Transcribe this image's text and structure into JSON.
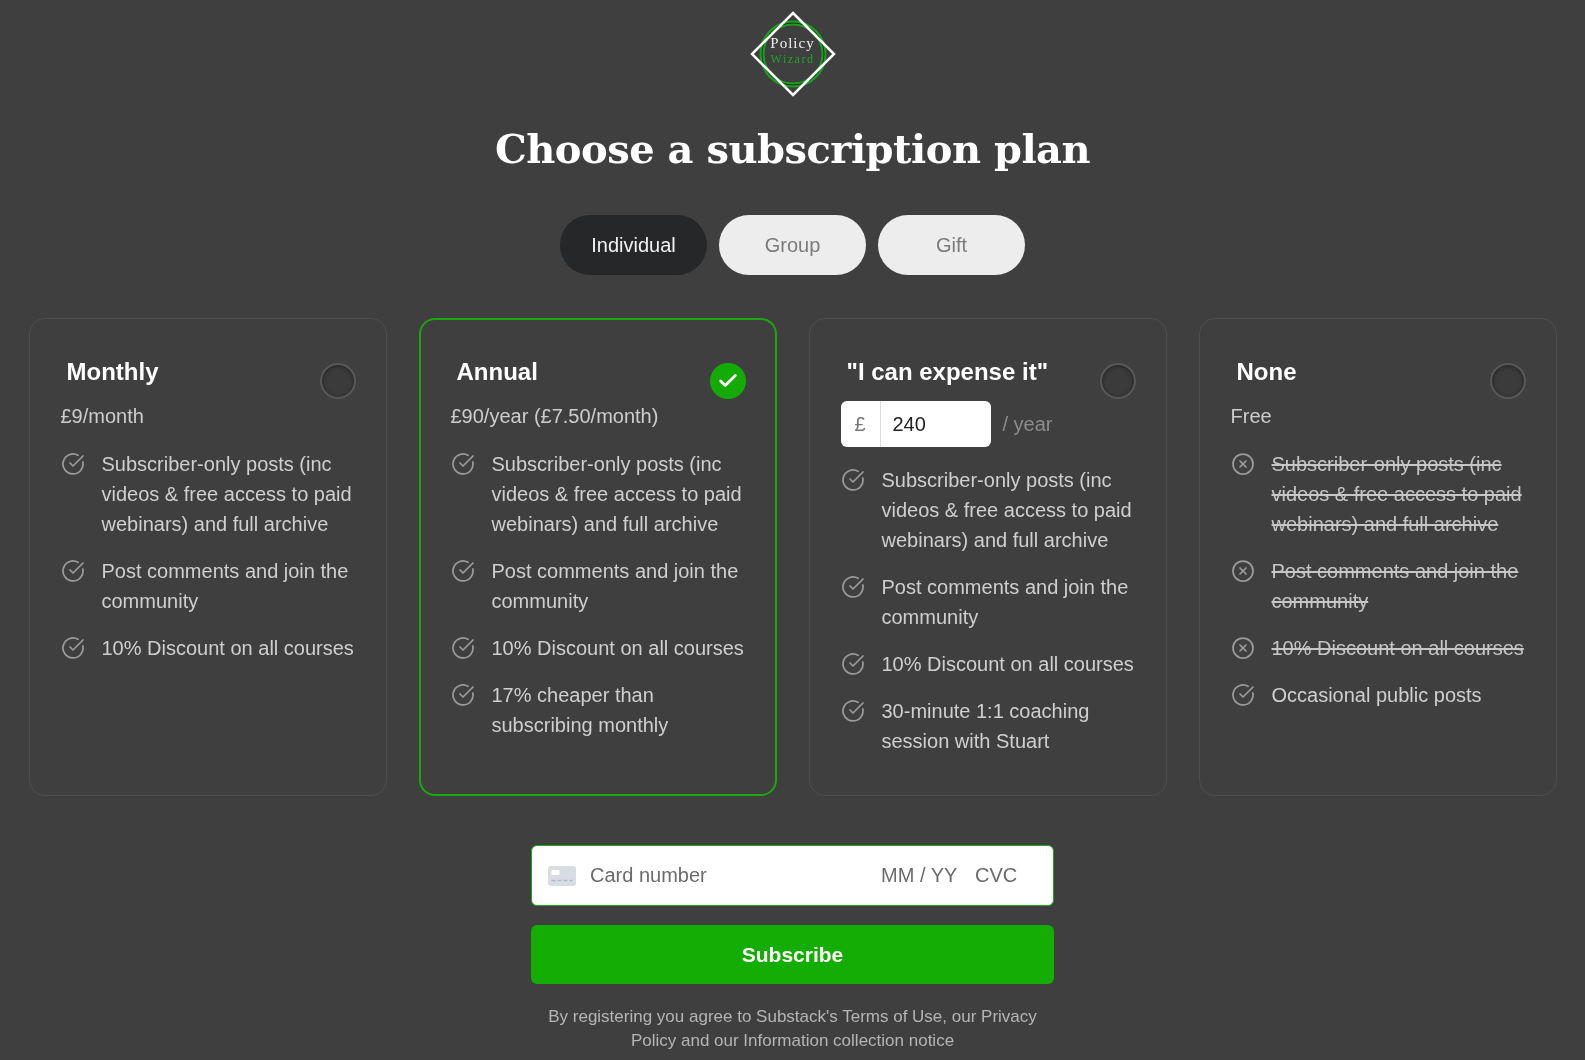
{
  "logo": {
    "line_1": "Policy",
    "line_2": "Wizard"
  },
  "title": "Choose a subscription plan",
  "tabs": [
    {
      "label": "Individual",
      "selected": true
    },
    {
      "label": "Group",
      "selected": false
    },
    {
      "label": "Gift",
      "selected": false
    }
  ],
  "plans": [
    {
      "kind": "fixed",
      "name": "Monthly",
      "price": "£9/month",
      "selected": false,
      "features": [
        {
          "text": "Subscriber-only posts (inc videos & free access to paid webinars) and full archive",
          "included": true
        },
        {
          "text": "Post comments and join the community",
          "included": true
        },
        {
          "text": "10% Discount on all courses",
          "included": true
        }
      ]
    },
    {
      "kind": "fixed",
      "name": "Annual",
      "price": "£90/year (£7.50/month)",
      "selected": true,
      "features": [
        {
          "text": "Subscriber-only posts (inc videos & free access to paid webinars) and full archive",
          "included": true
        },
        {
          "text": "Post comments and join the community",
          "included": true
        },
        {
          "text": "10% Discount on all courses",
          "included": true
        },
        {
          "text": "17% cheaper than subscribing monthly",
          "included": true
        }
      ]
    },
    {
      "kind": "custom",
      "name": "\"I can expense it\"",
      "amount_field": {
        "prefix": "£",
        "value": "240"
      },
      "period": "/ year",
      "selected": false,
      "features": [
        {
          "text": "Subscriber-only posts (inc videos & free access to paid webinars) and full archive",
          "included": true
        },
        {
          "text": "Post comments and join the community",
          "included": true
        },
        {
          "text": "10% Discount on all courses",
          "included": true
        },
        {
          "text": "30-minute 1:1 coaching session with Stuart",
          "included": true
        }
      ]
    },
    {
      "kind": "fixed",
      "name": "None",
      "price": "Free",
      "selected": false,
      "features": [
        {
          "text": "Subscriber-only posts (inc videos & free access to paid webinars) and full archive",
          "included": false
        },
        {
          "text": "Post comments and join the community",
          "included": false
        },
        {
          "text": "10% Discount on all courses",
          "included": false
        },
        {
          "text": "Occasional public posts",
          "included": true
        }
      ]
    }
  ],
  "card_field": {
    "number": {
      "placeholder": "Card number"
    },
    "expiry": {
      "placeholder": "MM / YY"
    },
    "cvc": {
      "placeholder": "CVC"
    }
  },
  "subscribe_button": "Subscribe",
  "legal_notice": "By registering you agree to Substack's Terms of Use, our Privacy Policy and our Information collection notice"
}
